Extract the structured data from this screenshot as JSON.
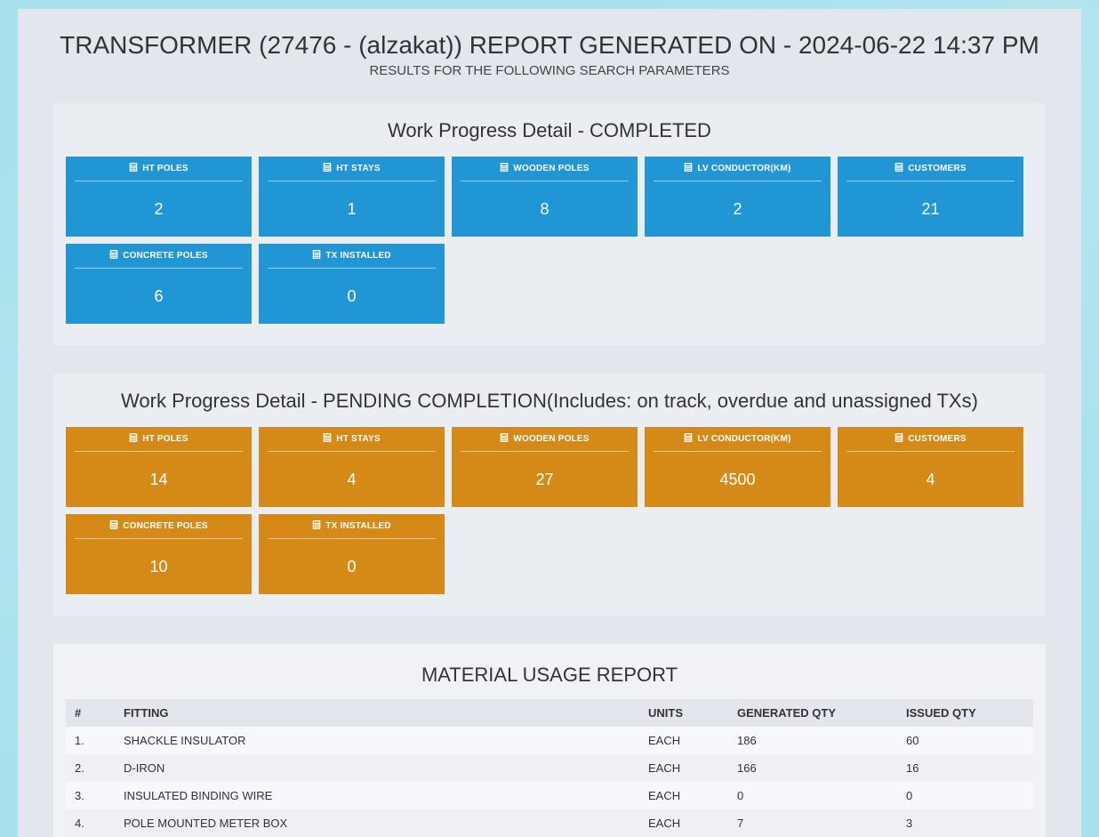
{
  "header": {
    "title": "TRANSFORMER (27476 - (alzakat)) REPORT GENERATED ON - 2024-06-22 14:37 PM",
    "subtitle": "RESULTS FOR THE FOLLOWING SEARCH PARAMETERS"
  },
  "completed": {
    "title": "Work Progress Detail - COMPLETED",
    "tiles": [
      {
        "label": "HT POLES",
        "value": "2"
      },
      {
        "label": "HT STAYS",
        "value": "1"
      },
      {
        "label": "WOODEN POLES",
        "value": "8"
      },
      {
        "label": "LV CONDUCTOR(KM)",
        "value": "2"
      },
      {
        "label": "CUSTOMERS",
        "value": "21"
      },
      {
        "label": "CONCRETE POLES",
        "value": "6"
      },
      {
        "label": "TX INSTALLED",
        "value": "0"
      }
    ]
  },
  "pending": {
    "title": "Work Progress Detail - PENDING COMPLETION(Includes: on track, overdue and unassigned TXs)",
    "tiles": [
      {
        "label": "HT POLES",
        "value": "14"
      },
      {
        "label": "HT STAYS",
        "value": "4"
      },
      {
        "label": "WOODEN POLES",
        "value": "27"
      },
      {
        "label": "LV CONDUCTOR(KM)",
        "value": "4500"
      },
      {
        "label": "CUSTOMERS",
        "value": "4"
      },
      {
        "label": "CONCRETE POLES",
        "value": "10"
      },
      {
        "label": "TX INSTALLED",
        "value": "0"
      }
    ]
  },
  "materials": {
    "title": "MATERIAL USAGE REPORT",
    "columns": {
      "num": "#",
      "fitting": "FITTING",
      "units": "UNITS",
      "gen": "GENERATED QTY",
      "iss": "ISSUED QTY"
    },
    "rows": [
      {
        "num": "1.",
        "fitting": "SHACKLE INSULATOR",
        "units": "EACH",
        "gen": "186",
        "iss": "60"
      },
      {
        "num": "2.",
        "fitting": "D-IRON",
        "units": "EACH",
        "gen": "166",
        "iss": "16"
      },
      {
        "num": "3.",
        "fitting": "INSULATED BINDING WIRE",
        "units": "EACH",
        "gen": "0",
        "iss": "0"
      },
      {
        "num": "4.",
        "fitting": "POLE MOUNTED METER BOX",
        "units": "EACH",
        "gen": "7",
        "iss": "3"
      }
    ]
  }
}
